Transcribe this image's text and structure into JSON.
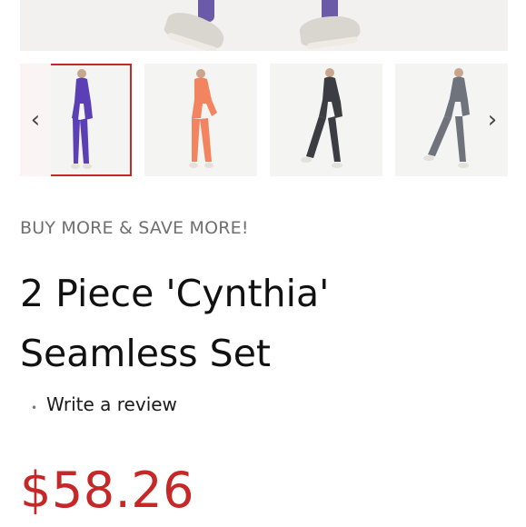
{
  "gallery": {
    "main_image_label": "product-main-image",
    "prev_icon": "chevron-left-icon",
    "next_icon": "chevron-right-icon",
    "prev_glyph": "‹",
    "next_glyph": "›",
    "thumbnails": [
      {
        "color_name": "purple",
        "garment_hex": "#5b3fb4",
        "selected": true
      },
      {
        "color_name": "coral",
        "garment_hex": "#f2845f",
        "selected": false
      },
      {
        "color_name": "charcoal",
        "garment_hex": "#3b3d42",
        "selected": false
      },
      {
        "color_name": "grey",
        "garment_hex": "#6f737c",
        "selected": false
      }
    ]
  },
  "product": {
    "promo": "BUY MORE & SAVE MORE!",
    "title": "2 Piece 'Cynthia' Seamless Set",
    "review_bullet": "•",
    "review_link": "Write a review",
    "price": "$58.26"
  },
  "colors": {
    "accent_red": "#c62828",
    "promo_grey": "#6f6f6f"
  }
}
